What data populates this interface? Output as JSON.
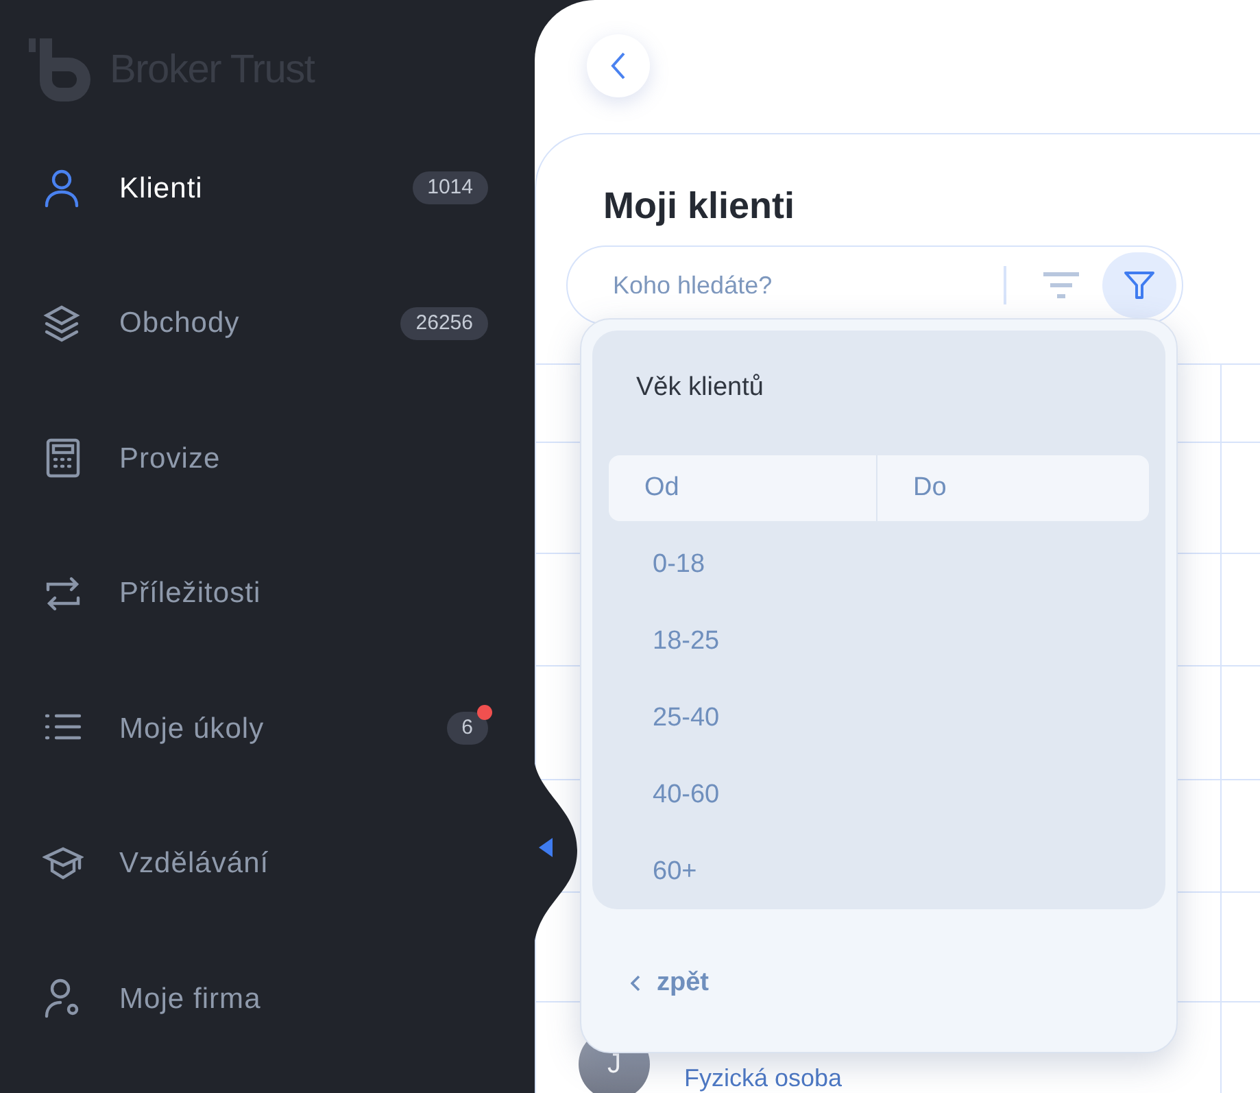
{
  "logo": {
    "text": "Broker Trust"
  },
  "sidebar": {
    "items": [
      {
        "label": "Klienti",
        "badge": "1014",
        "selected": true,
        "notification": false
      },
      {
        "label": "Obchody",
        "badge": "26256",
        "selected": false,
        "notification": false
      },
      {
        "label": "Provize",
        "selected": false,
        "notification": false
      },
      {
        "label": "Příležitosti",
        "selected": false,
        "notification": false
      },
      {
        "label": "Moje úkoly",
        "badge": "6",
        "selected": false,
        "notification": true
      },
      {
        "label": "Vzdělávání",
        "selected": false,
        "notification": false
      },
      {
        "label": "Moje firma",
        "selected": false,
        "notification": false
      }
    ]
  },
  "page": {
    "title": "Moji klienti",
    "search": {
      "placeholder": "Koho hledáte?"
    },
    "filter_active": true
  },
  "filter_popup": {
    "title": "Věk klientů",
    "from": {
      "placeholder": "Od"
    },
    "to": {
      "placeholder": "Do"
    },
    "options": [
      "0-18",
      "18-25",
      "25-40",
      "40-60",
      "60+"
    ],
    "back": "zpět"
  },
  "visible_row": {
    "avatar": "J",
    "subtitle": "Fyzická osoba"
  }
}
